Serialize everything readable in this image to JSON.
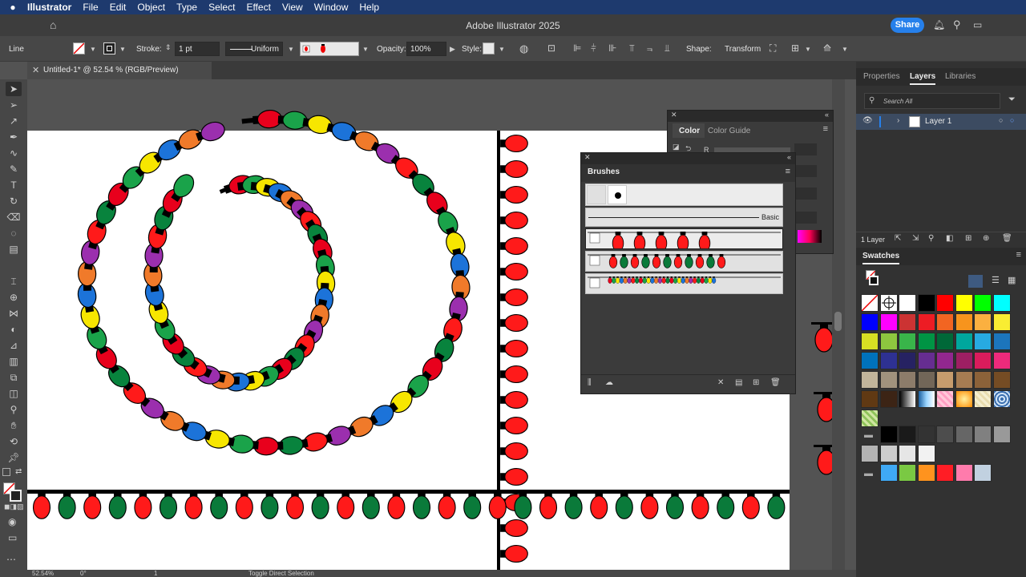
{
  "menubar": {
    "apple": "",
    "app": "Illustrator",
    "items": [
      "File",
      "Edit",
      "Object",
      "Type",
      "Select",
      "Effect",
      "View",
      "Window",
      "Help"
    ]
  },
  "titlebar": {
    "title": "Adobe Illustrator 2025",
    "share_label": "Share"
  },
  "control_bar": {
    "selection_type": "Line",
    "stroke_label": "Stroke:",
    "stroke_value": "1 pt",
    "profile_value": "Uniform",
    "opacity_label": "Opacity:",
    "opacity_value": "100%",
    "style_label": "Style:",
    "shape_label": "Shape:",
    "transform_label": "Transform"
  },
  "document": {
    "tab_title": "Untitled-1* @ 52.54 % (RGB/Preview)"
  },
  "right_panel": {
    "tabs": [
      "Properties",
      "Layers",
      "Libraries"
    ],
    "active_tab": "Layers",
    "search_placeholder": "Search All",
    "layer_name": "Layer 1",
    "layer_count": "1 Layer",
    "swatches_title": "Swatches"
  },
  "color_panel": {
    "tabs": [
      "Color",
      "Color Guide"
    ],
    "active_tab": "Color",
    "channel_label": "R"
  },
  "brushes_panel": {
    "title": "Brushes",
    "basic_label": "Basic"
  },
  "status_bar": {
    "zoom": "52.54%",
    "rotation": "0°",
    "artboard": "1",
    "tool_hint": "Toggle Direct Selection"
  },
  "colors": {
    "bulb_red": "#ff1a1a",
    "bulb_green": "#0a7a3a",
    "accent_blue": "#2680eb",
    "palette": [
      "#e8001c",
      "#1aa34a",
      "#f7e600",
      "#1c73d9",
      "#f07a2a",
      "#9b2fae",
      "#ff1a1a",
      "#08833d"
    ]
  },
  "swatches": {
    "row1": [
      "none",
      "registration",
      "#ffffff",
      "#000000",
      "#ff0000",
      "#ffff00",
      "#00ff00",
      "#00ffff"
    ],
    "row2": [
      "#0000ff",
      "#ff00ff",
      "#cc3333",
      "#ed1c24",
      "#f26522",
      "#f7941d",
      "#fbb040",
      "#f9ed32"
    ],
    "row3": [
      "#d7df23",
      "#8dc63f",
      "#39b54a",
      "#009444",
      "#006838",
      "#00a79d",
      "#27aae1",
      "#1c75bc"
    ],
    "row4": [
      "#0072bc",
      "#2e3192",
      "#262262",
      "#662d91",
      "#92278f",
      "#9e1f63",
      "#da1c5c",
      "#ee2a7b"
    ],
    "row5": [
      "#c2b59b",
      "#a0927d",
      "#8c7c6a",
      "#726658",
      "#c69c6d",
      "#a67c52",
      "#8c6239",
      "#754c24"
    ],
    "row6": [
      "#603913",
      "#3c2415",
      "gradient-gray",
      "gradient-blue",
      "pattern-pink",
      "gradient-orange",
      "pattern-cream",
      "pattern-blue"
    ],
    "row7": [
      "pattern-green"
    ],
    "grays": [
      "#000000",
      "#1a1a1a",
      "#333333",
      "#4d4d4d",
      "#666666",
      "#808080",
      "#999999",
      "#b3b3b3",
      "#cccccc",
      "#e6e6e6",
      "#f2f2f2"
    ],
    "brights": [
      "#3fa9f5",
      "#7ac943",
      "#ff931e",
      "#ff1d25",
      "#ff7bac",
      "#c1d1e0"
    ]
  }
}
